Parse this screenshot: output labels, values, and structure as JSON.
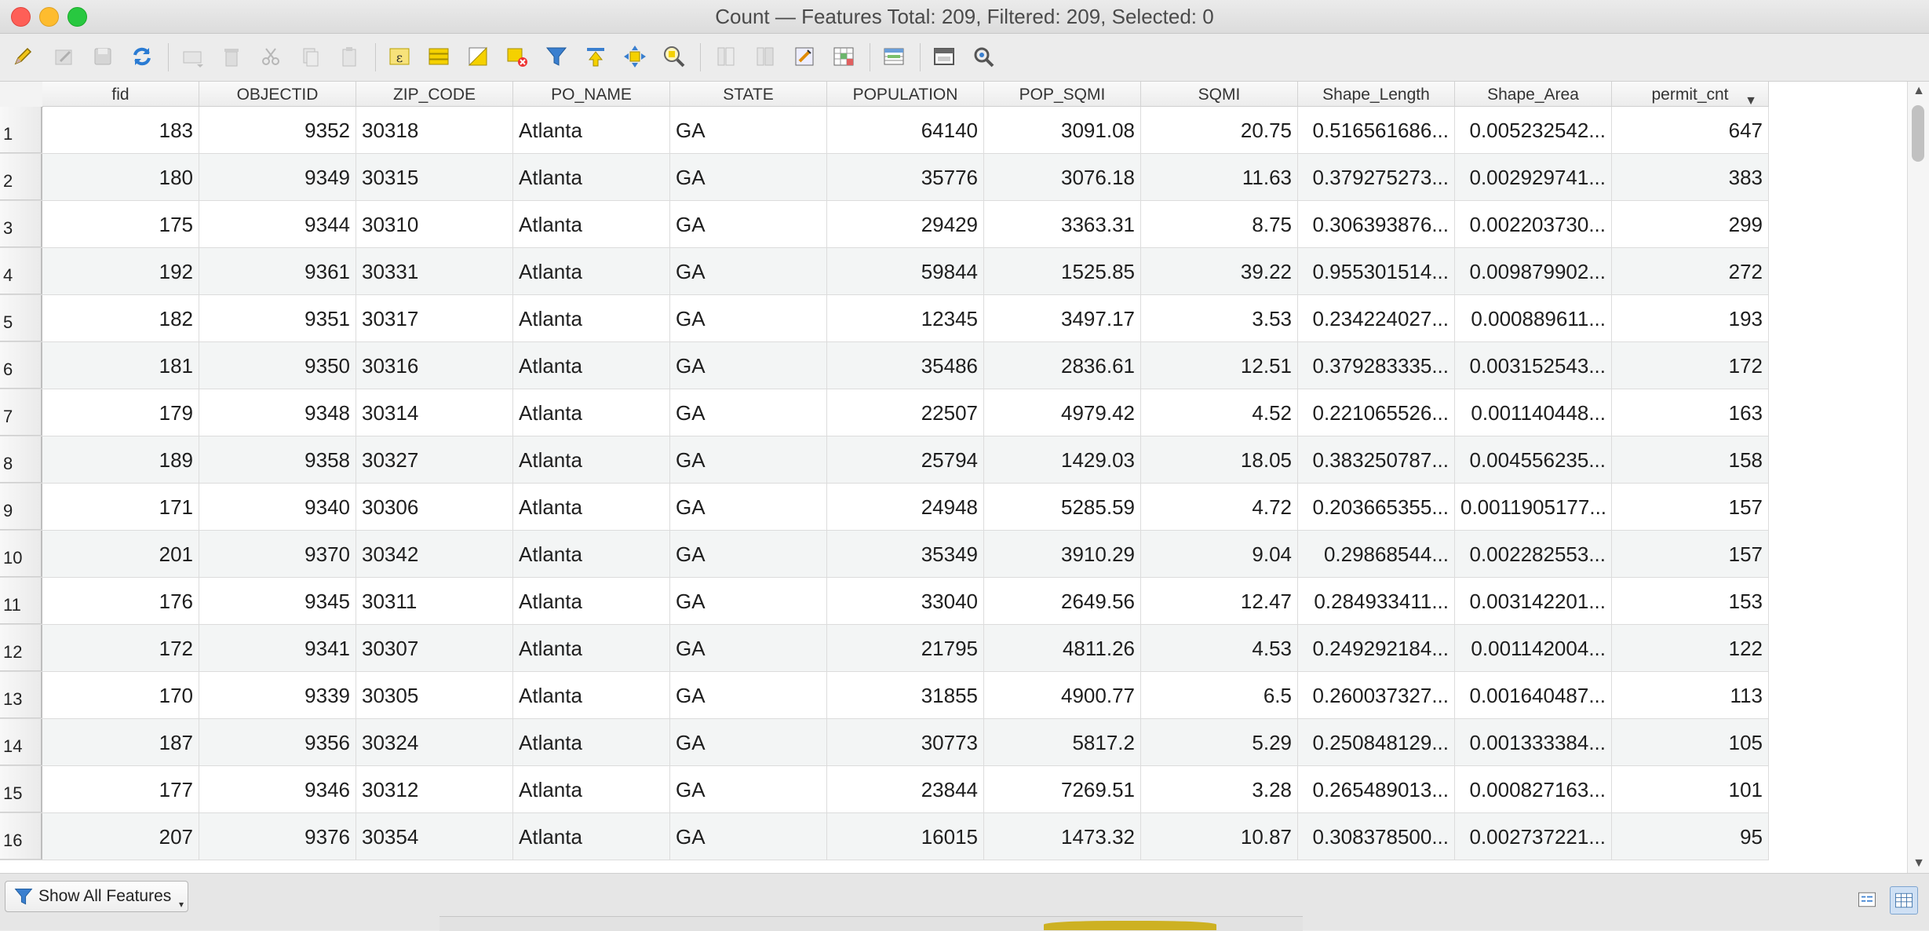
{
  "window": {
    "title": "Count — Features Total: 209, Filtered: 209, Selected: 0"
  },
  "toolbar": {
    "buttons": [
      {
        "name": "toggle-editing-pencil-icon",
        "enabled": true
      },
      {
        "name": "multi-edit-icon",
        "enabled": false
      },
      {
        "name": "save-edits-icon",
        "enabled": false
      },
      {
        "name": "reload-table-icon",
        "enabled": true
      },
      {
        "name": "add-feature-icon",
        "enabled": false
      },
      {
        "name": "delete-feature-icon",
        "enabled": false
      },
      {
        "name": "cut-icon",
        "enabled": false
      },
      {
        "name": "copy-icon",
        "enabled": false
      },
      {
        "name": "paste-icon",
        "enabled": false
      },
      {
        "name": "select-by-expression-icon",
        "enabled": true
      },
      {
        "name": "select-all-icon",
        "enabled": true
      },
      {
        "name": "invert-selection-icon",
        "enabled": true
      },
      {
        "name": "deselect-all-icon",
        "enabled": true
      },
      {
        "name": "filter-select-icon",
        "enabled": true
      },
      {
        "name": "move-selection-top-icon",
        "enabled": true
      },
      {
        "name": "pan-to-selected-icon",
        "enabled": true
      },
      {
        "name": "zoom-to-selected-icon",
        "enabled": true
      },
      {
        "name": "new-field-icon",
        "enabled": false
      },
      {
        "name": "delete-field-icon",
        "enabled": false
      },
      {
        "name": "field-calculator-icon",
        "enabled": true
      },
      {
        "name": "conditional-formatting-icon",
        "enabled": true
      },
      {
        "name": "organize-columns-icon",
        "enabled": true
      },
      {
        "name": "dock-table-icon",
        "enabled": true
      },
      {
        "name": "actions-icon",
        "enabled": true
      }
    ]
  },
  "table": {
    "columns": [
      "fid",
      "OBJECTID",
      "ZIP_CODE",
      "PO_NAME",
      "STATE",
      "POPULATION",
      "POP_SQMI",
      "SQMI",
      "Shape_Length",
      "Shape_Area",
      "permit_cnt"
    ],
    "sorted_column": "permit_cnt",
    "sort_direction": "descending",
    "rows": [
      {
        "n": "1",
        "cells": [
          "183",
          "9352",
          "30318",
          "Atlanta",
          "GA",
          "64140",
          "3091.08",
          "20.75",
          "0.516561686...",
          "0.005232542...",
          "647"
        ]
      },
      {
        "n": "2",
        "cells": [
          "180",
          "9349",
          "30315",
          "Atlanta",
          "GA",
          "35776",
          "3076.18",
          "11.63",
          "0.379275273...",
          "0.002929741...",
          "383"
        ]
      },
      {
        "n": "3",
        "cells": [
          "175",
          "9344",
          "30310",
          "Atlanta",
          "GA",
          "29429",
          "3363.31",
          "8.75",
          "0.306393876...",
          "0.002203730...",
          "299"
        ]
      },
      {
        "n": "4",
        "cells": [
          "192",
          "9361",
          "30331",
          "Atlanta",
          "GA",
          "59844",
          "1525.85",
          "39.22",
          "0.955301514...",
          "0.009879902...",
          "272"
        ]
      },
      {
        "n": "5",
        "cells": [
          "182",
          "9351",
          "30317",
          "Atlanta",
          "GA",
          "12345",
          "3497.17",
          "3.53",
          "0.234224027...",
          "0.000889611...",
          "193"
        ]
      },
      {
        "n": "6",
        "cells": [
          "181",
          "9350",
          "30316",
          "Atlanta",
          "GA",
          "35486",
          "2836.61",
          "12.51",
          "0.379283335...",
          "0.003152543...",
          "172"
        ]
      },
      {
        "n": "7",
        "cells": [
          "179",
          "9348",
          "30314",
          "Atlanta",
          "GA",
          "22507",
          "4979.42",
          "4.52",
          "0.221065526...",
          "0.001140448...",
          "163"
        ]
      },
      {
        "n": "8",
        "cells": [
          "189",
          "9358",
          "30327",
          "Atlanta",
          "GA",
          "25794",
          "1429.03",
          "18.05",
          "0.383250787...",
          "0.004556235...",
          "158"
        ]
      },
      {
        "n": "9",
        "cells": [
          "171",
          "9340",
          "30306",
          "Atlanta",
          "GA",
          "24948",
          "5285.59",
          "4.72",
          "0.203665355...",
          "0.0011905177...",
          "157"
        ]
      },
      {
        "n": "10",
        "cells": [
          "201",
          "9370",
          "30342",
          "Atlanta",
          "GA",
          "35349",
          "3910.29",
          "9.04",
          "0.29868544...",
          "0.002282553...",
          "157"
        ]
      },
      {
        "n": "11",
        "cells": [
          "176",
          "9345",
          "30311",
          "Atlanta",
          "GA",
          "33040",
          "2649.56",
          "12.47",
          "0.284933411...",
          "0.003142201...",
          "153"
        ]
      },
      {
        "n": "12",
        "cells": [
          "172",
          "9341",
          "30307",
          "Atlanta",
          "GA",
          "21795",
          "4811.26",
          "4.53",
          "0.249292184...",
          "0.001142004...",
          "122"
        ]
      },
      {
        "n": "13",
        "cells": [
          "170",
          "9339",
          "30305",
          "Atlanta",
          "GA",
          "31855",
          "4900.77",
          "6.5",
          "0.260037327...",
          "0.001640487...",
          "113"
        ]
      },
      {
        "n": "14",
        "cells": [
          "187",
          "9356",
          "30324",
          "Atlanta",
          "GA",
          "30773",
          "5817.2",
          "5.29",
          "0.250848129...",
          "0.001333384...",
          "105"
        ]
      },
      {
        "n": "15",
        "cells": [
          "177",
          "9346",
          "30312",
          "Atlanta",
          "GA",
          "23844",
          "7269.51",
          "3.28",
          "0.265489013...",
          "0.000827163...",
          "101"
        ]
      },
      {
        "n": "16",
        "cells": [
          "207",
          "9376",
          "30354",
          "Atlanta",
          "GA",
          "16015",
          "1473.32",
          "10.87",
          "0.308378500...",
          "0.002737221...",
          "95"
        ]
      }
    ]
  },
  "footer": {
    "filter_button_label": "Show All Features",
    "view_modes": [
      "form-view-icon",
      "table-view-icon"
    ],
    "active_view": "table-view-icon"
  }
}
